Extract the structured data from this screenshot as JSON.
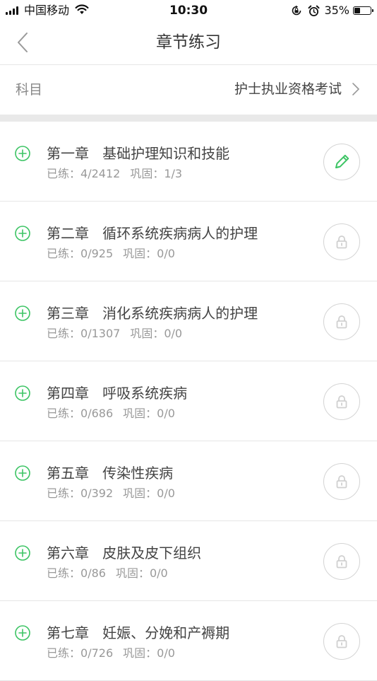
{
  "status_bar": {
    "carrier": "中国移动",
    "time": "10:30",
    "battery_percent_label": "35%",
    "battery_level": 0.35,
    "icons": [
      "signal-icon",
      "wifi-icon",
      "orientation-lock-icon",
      "alarm-icon",
      "battery-icon"
    ]
  },
  "nav": {
    "title": "章节练习",
    "back_icon": "chevron-left-icon"
  },
  "subject": {
    "label": "科目",
    "value": "护士执业资格考试",
    "chevron_icon": "chevron-right-icon"
  },
  "colors": {
    "accent": "#3cc464",
    "lock": "#d0d0d0",
    "divider": "#e6e6e6",
    "section_gap": "#e9e9e9"
  },
  "chapters": [
    {
      "title": "第一章   基础护理知识和技能",
      "practiced_label": "已练：",
      "practiced_value": "4/2412",
      "consolidated_label": "巩固：",
      "consolidated_value": "1/3",
      "action_icon": "pencil-icon",
      "unlocked": true
    },
    {
      "title": "第二章   循环系统疾病病人的护理",
      "practiced_label": "已练：",
      "practiced_value": "0/925",
      "consolidated_label": "巩固：",
      "consolidated_value": "0/0",
      "action_icon": "lock-icon",
      "unlocked": false
    },
    {
      "title": "第三章   消化系统疾病病人的护理",
      "practiced_label": "已练：",
      "practiced_value": "0/1307",
      "consolidated_label": "巩固：",
      "consolidated_value": "0/0",
      "action_icon": "lock-icon",
      "unlocked": false
    },
    {
      "title": "第四章   呼吸系统疾病",
      "practiced_label": "已练：",
      "practiced_value": "0/686",
      "consolidated_label": "巩固：",
      "consolidated_value": "0/0",
      "action_icon": "lock-icon",
      "unlocked": false
    },
    {
      "title": "第五章   传染性疾病",
      "practiced_label": "已练：",
      "practiced_value": "0/392",
      "consolidated_label": "巩固：",
      "consolidated_value": "0/0",
      "action_icon": "lock-icon",
      "unlocked": false
    },
    {
      "title": "第六章   皮肤及皮下组织",
      "practiced_label": "已练：",
      "practiced_value": "0/86",
      "consolidated_label": "巩固：",
      "consolidated_value": "0/0",
      "action_icon": "lock-icon",
      "unlocked": false
    },
    {
      "title": "第七章   妊娠、分娩和产褥期",
      "practiced_label": "已练：",
      "practiced_value": "0/726",
      "consolidated_label": "巩固：",
      "consolidated_value": "0/0",
      "action_icon": "lock-icon",
      "unlocked": false
    }
  ]
}
